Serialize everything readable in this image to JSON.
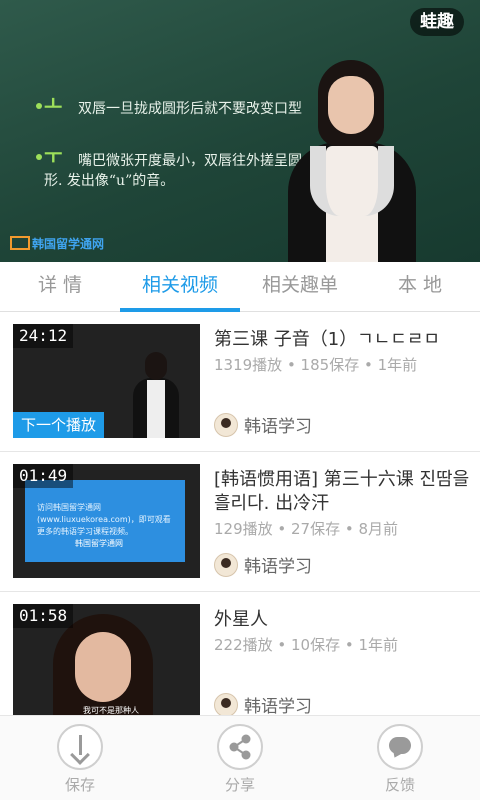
{
  "player": {
    "brand_badge": "蛙趣",
    "board": {
      "line1_jamo": "ㅗ",
      "line1_text": "双唇一旦拢成圆形后就不要改变口型",
      "line2_jamo": "ㅜ",
      "line2_text_a": "嘴巴微张开度最小，双唇往外搓呈圆",
      "line2_text_b": "形. 发出像“u”的音。"
    },
    "watermark": "韩国留学通网"
  },
  "tabs": [
    {
      "label": "详 情",
      "active": false
    },
    {
      "label": "相关视频",
      "active": true
    },
    {
      "label": "相关趣单",
      "active": false
    },
    {
      "label": "本 地",
      "active": false
    }
  ],
  "videos": [
    {
      "duration": "24:12",
      "badge": "下一个播放",
      "title": "第三课 子音（1）ㄱㄴㄷㄹㅁ",
      "meta": "1319播放 • 185保存 • 1年前",
      "uploader": "韩语学习"
    },
    {
      "duration": "01:49",
      "title": "[韩语惯用语] 第三十六课 진땀을 흘리다. 出冷汗",
      "meta": "129播放 • 27保存 • 8月前",
      "uploader": "韩语学习",
      "screen_text": "访问韩国留学通网(www.liuxuekorea.com)，即可观看更多的韩语学习课程视频。",
      "screen_logo": "韩国留学通网"
    },
    {
      "duration": "01:58",
      "title": "外星人",
      "meta": "222播放 • 10保存 • 1年前",
      "uploader": "韩语学习",
      "subtitle": "我可不是那种人"
    }
  ],
  "bottom_bar": [
    {
      "label": "保存",
      "icon": "download-icon"
    },
    {
      "label": "分享",
      "icon": "share-icon"
    },
    {
      "label": "反馈",
      "icon": "chat-bubble-icon"
    }
  ],
  "colors": {
    "accent": "#1e9be8",
    "board": "#1f4538"
  }
}
